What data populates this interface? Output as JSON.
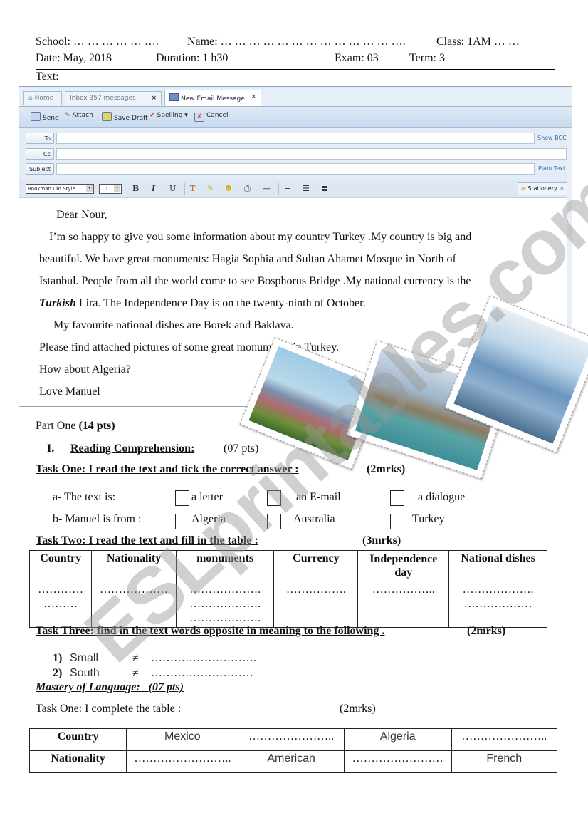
{
  "header": {
    "school": "School: … … … … … ….",
    "name": "Name: … … … … … … … … … … … … ….",
    "class": "Class: 1AM … …",
    "date": "Date: May, 2018",
    "duration": "Duration: 1 h30",
    "exam": "Exam: 03",
    "term": "Term: 3",
    "text_label": "Text:"
  },
  "email_window": {
    "tabs": [
      {
        "label": "Home",
        "icon": "home-icon"
      },
      {
        "label": "Inbox 357 messages",
        "close": "×"
      },
      {
        "label": "New Email Message",
        "close": "×",
        "active": true,
        "icon": "email-icon"
      }
    ],
    "toolbar": [
      {
        "label": "Send",
        "icon": "send-icon"
      },
      {
        "label": "Attach",
        "icon": "paperclip-icon"
      },
      {
        "label": "Save Draft",
        "icon": "save-icon"
      },
      {
        "label": "Spelling ▾",
        "icon": "spellcheck-icon"
      },
      {
        "label": "Cancel",
        "icon": "cancel-icon"
      }
    ],
    "fields": {
      "to_label": "To",
      "to_value": "|",
      "cc_label": "Cc",
      "subject_label": "Subject",
      "show_bcc": "Show BCC",
      "plain_text": "Plain Text"
    },
    "format": {
      "font": "Bookman Old Style",
      "size": "10",
      "bold": "B",
      "italic": "I",
      "underline": "U",
      "stationery": "Stationery"
    },
    "body": {
      "greeting": "Dear Nour,",
      "line1": "I’m so happy to give you some information  about my country Turkey .My country is big and",
      "line2": "beautiful. We have great monuments: Hagia Sophia and Sultan Ahamet  Mosque in North of",
      "line3": "Istanbul. People from all the world come to see Bosphorus Bridge .My national currency is the",
      "line4_italic": "Turkish",
      "line4_rest": " Lira. The Independence Day is on the twenty-ninth of October.",
      "line5": "My favourite national dishes are Borek and Baklava.",
      "line6": "Please find attached pictures of some great monuments in Turkey.",
      "line7": "How about Algeria?",
      "line8": "Love Manuel"
    }
  },
  "photos": [
    {
      "subject": "Hagia Sophia"
    },
    {
      "subject": "Bosphorus Bridge"
    },
    {
      "subject": "Sultan Ahmet (Blue) Mosque"
    }
  ],
  "part_one": {
    "title_a": "Part One ",
    "title_b": "(14 pts)",
    "section_num": "I.",
    "section_title": "Reading Comprehension:",
    "section_pts": "(07 pts)",
    "task1": {
      "title": "Task One: I read the text and tick the correct answer :",
      "marks": "(2mrks)",
      "a_label": "a-  The text is:",
      "a_options": [
        "a letter",
        "an E-mail",
        "a dialogue"
      ],
      "b_label": "b-  Manuel is from :",
      "b_options": [
        "Algeria",
        "Australia",
        "Turkey"
      ]
    },
    "task2": {
      "title": "Task Two: I read the text and fill in the table :",
      "marks": "(3mrks)",
      "headers": [
        "Country",
        "Nationality",
        "monuments",
        "Currency",
        "Independence day",
        "National dishes"
      ],
      "cells": [
        "…………\n………",
        "………………",
        "……………….\n……………….\n……………….",
        "…………….",
        "……………..",
        "……………….\n………………"
      ]
    },
    "task3": {
      "title": "Task Three: find in the text words opposite in meaning to the following .",
      "marks": "(2mrks)",
      "items": [
        {
          "num": "1)",
          "word": "Small",
          "sign": "≠",
          "blank": "………………………."
        },
        {
          "num": "2)",
          "word": "South",
          "sign": "≠",
          "blank": "………………………"
        }
      ]
    }
  },
  "mastery": {
    "title": "Mastery of  Language:",
    "pts": "(07 pts)",
    "task1": {
      "title": "Task One: I complete the table :",
      "marks": "(2mrks)",
      "row1": [
        "Country",
        "Mexico",
        "…………………..",
        "Algeria",
        "………………….."
      ],
      "row2": [
        "Nationality",
        "……………………..",
        "American",
        "……………………",
        "French"
      ]
    }
  },
  "watermark": "ESLprintables.com"
}
